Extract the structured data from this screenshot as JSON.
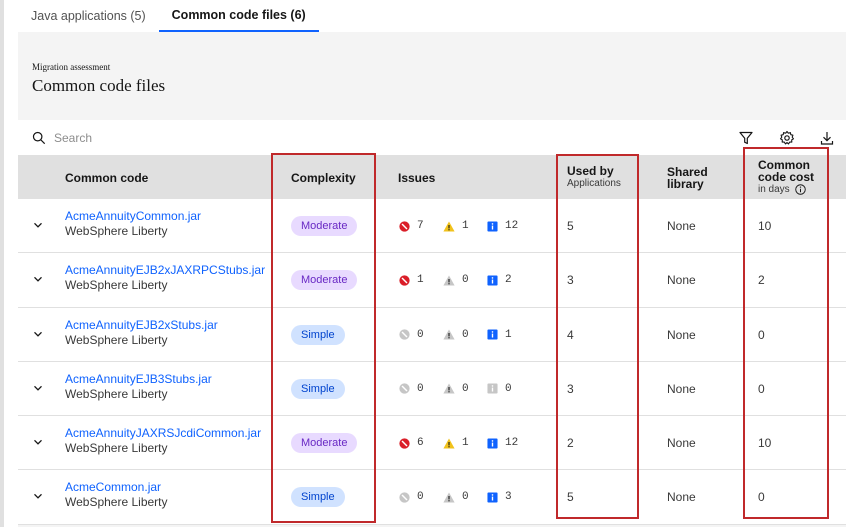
{
  "tabs": [
    {
      "label": "Java applications (5)",
      "active": false
    },
    {
      "label": "Common code files (6)",
      "active": true
    }
  ],
  "header": {
    "eyebrow": "Migration assessment",
    "title": "Common code files"
  },
  "search": {
    "placeholder": "Search",
    "value": ""
  },
  "toolbar_icons": [
    "filter-icon",
    "settings-icon",
    "download-icon"
  ],
  "table": {
    "columns": {
      "common_code": "Common code",
      "complexity": "Complexity",
      "issues": "Issues",
      "used_by": "Used by",
      "used_by_sub": "Applications",
      "shared_library": "Shared library",
      "cost": "Common code cost",
      "cost_sub": "in days"
    },
    "rows": [
      {
        "name": "AcmeAnnuityCommon.jar",
        "server": "WebSphere Liberty",
        "complexity": "Moderate",
        "critical": "7",
        "warning": "1",
        "info": "12",
        "used_by": "5",
        "shared": "None",
        "cost": "10"
      },
      {
        "name": "AcmeAnnuityEJB2xJAXRPCStubs.jar",
        "server": "WebSphere Liberty",
        "complexity": "Moderate",
        "critical": "1",
        "warning": "0",
        "info": "2",
        "used_by": "3",
        "shared": "None",
        "cost": "2"
      },
      {
        "name": "AcmeAnnuityEJB2xStubs.jar",
        "server": "WebSphere Liberty",
        "complexity": "Simple",
        "critical": "0",
        "warning": "0",
        "info": "1",
        "used_by": "4",
        "shared": "None",
        "cost": "0"
      },
      {
        "name": "AcmeAnnuityEJB3Stubs.jar",
        "server": "WebSphere Liberty",
        "complexity": "Simple",
        "critical": "0",
        "warning": "0",
        "info": "0",
        "used_by": "3",
        "shared": "None",
        "cost": "0"
      },
      {
        "name": "AcmeAnnuityJAXRSJcdiCommon.jar",
        "server": "WebSphere Liberty",
        "complexity": "Moderate",
        "critical": "6",
        "warning": "1",
        "info": "12",
        "used_by": "2",
        "shared": "None",
        "cost": "10"
      },
      {
        "name": "AcmeCommon.jar",
        "server": "WebSphere Liberty",
        "complexity": "Simple",
        "critical": "0",
        "warning": "0",
        "info": "3",
        "used_by": "5",
        "shared": "None",
        "cost": "0"
      }
    ]
  },
  "colors": {
    "accent": "#0f62fe",
    "critical": "#da1e28",
    "warning": "#f1c21b",
    "info": "#0f62fe",
    "inactive": "#c6c6c6",
    "highlight_box": "#c0292b"
  }
}
